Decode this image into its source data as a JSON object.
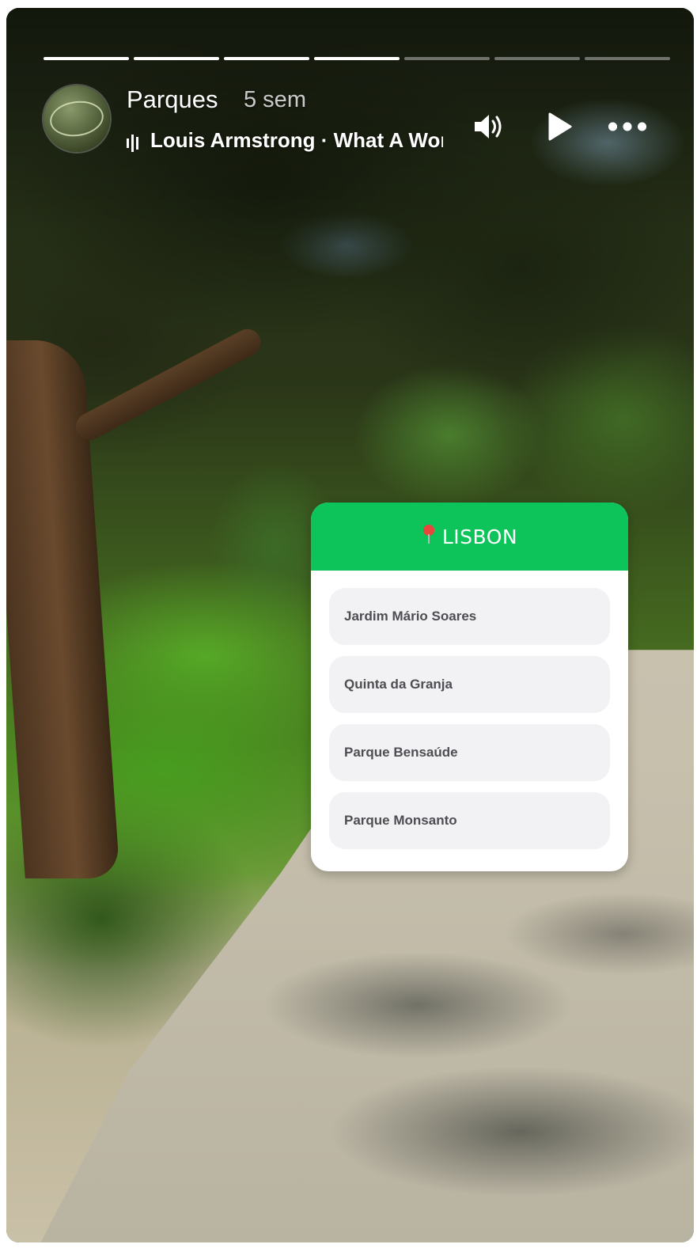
{
  "story": {
    "progress_segments": [
      1,
      1,
      1,
      1,
      0,
      0,
      0
    ]
  },
  "header": {
    "account_name": "Parques",
    "time_ago": "5 sem",
    "music_track": "Louis Armstrong · What A Wonderful World",
    "icons": {
      "music": "music-bars-icon",
      "sound": "speaker-icon",
      "play": "play-icon",
      "more": "more-dots-icon"
    }
  },
  "sticker": {
    "title": "LISBON",
    "title_icon": "map-pin-icon",
    "header_color": "#0cc45a",
    "items": [
      {
        "label": "Jardim Mário Soares"
      },
      {
        "label": "Quinta da Granja"
      },
      {
        "label": "Parque Bensaúde"
      },
      {
        "label": "Parque Monsanto"
      }
    ]
  }
}
